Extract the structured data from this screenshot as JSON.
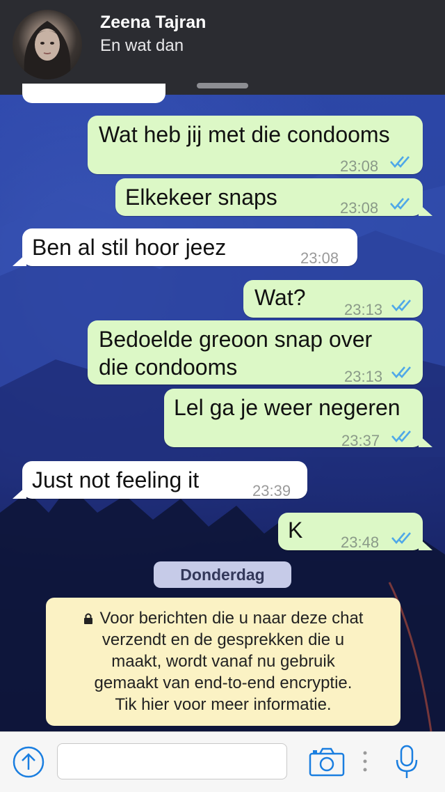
{
  "notification": {
    "contact_name": "Zeena Tajran",
    "preview": "En wat dan"
  },
  "messages": [
    {
      "direction": "out",
      "text": "Wat heb jij met die condooms",
      "time": "23:08",
      "read": true
    },
    {
      "direction": "out",
      "text": "Elkekeer snaps",
      "time": "23:08",
      "read": true
    },
    {
      "direction": "in",
      "text": "Ben al stil hoor jeez",
      "time": "23:08"
    },
    {
      "direction": "out",
      "text": "Wat?",
      "time": "23:13",
      "read": true
    },
    {
      "direction": "out",
      "text_line1": "Bedoelde greoon snap over",
      "text_line2": "die condooms",
      "time": "23:13",
      "read": true
    },
    {
      "direction": "out",
      "text": "Lel ga je weer negeren",
      "time": "23:37",
      "read": true
    },
    {
      "direction": "in",
      "text": "Just not feeling it",
      "time": "23:39"
    },
    {
      "direction": "out",
      "text": "K",
      "time": "23:48",
      "read": true
    }
  ],
  "date_separator": "Donderdag",
  "encryption_notice": {
    "line1": "Voor berichten die u naar deze chat",
    "line2": "verzendt en de gesprekken die u",
    "line3": "maakt, wordt vanaf nu gebruik",
    "line4": "gemaakt van end-to-end encryptie.",
    "line5": "Tik hier voor meer informatie."
  },
  "input_bar": {
    "placeholder": ""
  },
  "colors": {
    "outgoing_bubble": "#dcf8c6",
    "incoming_bubble": "#ffffff",
    "read_ticks": "#4fa8e8",
    "icon_blue": "#1a7ee0",
    "notice_bg": "#fbf2c4"
  }
}
